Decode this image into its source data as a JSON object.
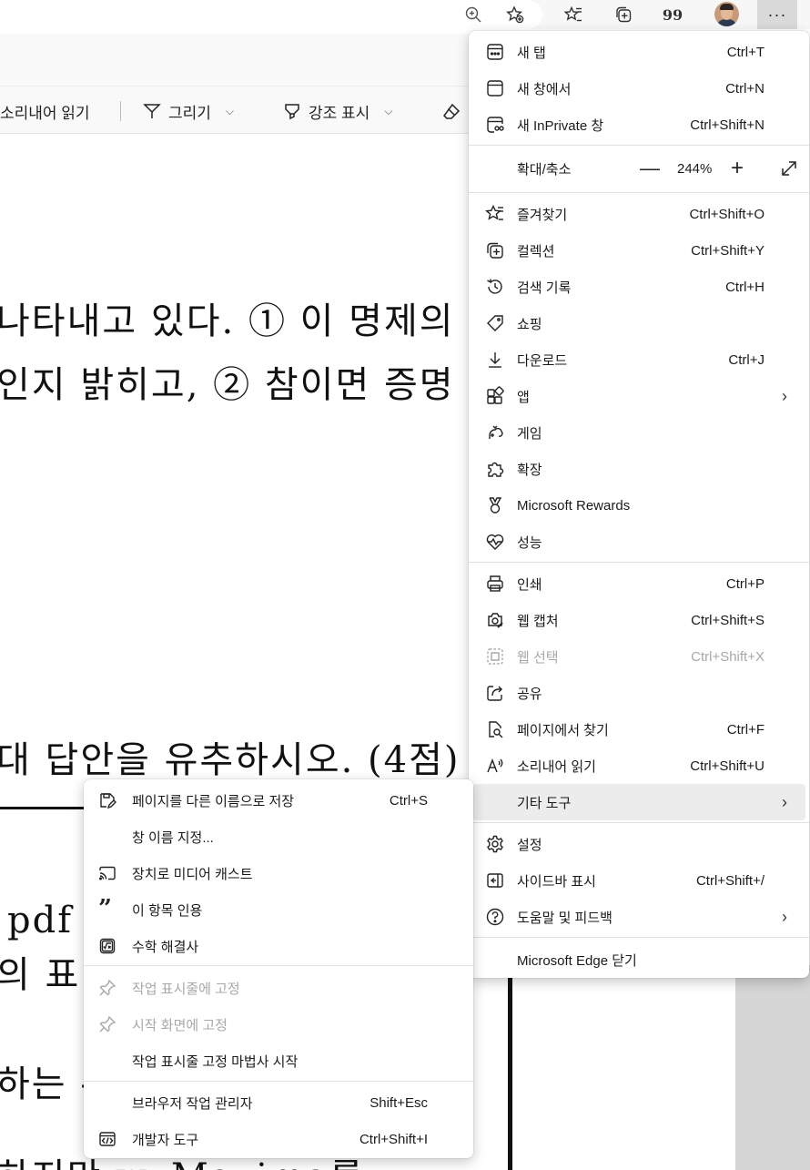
{
  "toolbar": {
    "icons": [
      "zoom-in-icon",
      "favorite-add-icon",
      "favorites-icon",
      "collections-icon",
      "citation-icon",
      "avatar",
      "more-icon"
    ],
    "citation_glyph": "99",
    "more_glyph": "···"
  },
  "pdf_toolbar": {
    "read_aloud": "소리내어 읽기",
    "draw": "그리기",
    "highlight": "강조 표시"
  },
  "document": {
    "line1": "나타내고 있다. ① 이 명제의",
    "line2": "인지 밝히고, ② 참이면 증명",
    "line3": "대 답안을 유추하시오. (4점)",
    "line4": "pdf",
    "line5": "의 표",
    "line6": "하는 -",
    "line7": "하지만 wxMaxima를"
  },
  "menu": {
    "new_tab": {
      "label": "새 탭",
      "shortcut": "Ctrl+T"
    },
    "new_window": {
      "label": "새 창에서",
      "shortcut": "Ctrl+N"
    },
    "inprivate": {
      "label": "새 InPrivate 창",
      "shortcut": "Ctrl+Shift+N"
    },
    "zoom": {
      "label": "확대/축소",
      "minus": "—",
      "value": "244%",
      "plus": "+"
    },
    "favorites": {
      "label": "즐겨찾기",
      "shortcut": "Ctrl+Shift+O"
    },
    "collections": {
      "label": "컬렉션",
      "shortcut": "Ctrl+Shift+Y"
    },
    "history": {
      "label": "검색 기록",
      "shortcut": "Ctrl+H"
    },
    "shopping": {
      "label": "쇼핑"
    },
    "downloads": {
      "label": "다운로드",
      "shortcut": "Ctrl+J"
    },
    "apps": {
      "label": "앱"
    },
    "games": {
      "label": "게임"
    },
    "extensions": {
      "label": "확장"
    },
    "rewards": {
      "label": "Microsoft Rewards"
    },
    "performance": {
      "label": "성능"
    },
    "print": {
      "label": "인쇄",
      "shortcut": "Ctrl+P"
    },
    "web_capture": {
      "label": "웹 캡처",
      "shortcut": "Ctrl+Shift+S"
    },
    "web_select": {
      "label": "웹 선택",
      "shortcut": "Ctrl+Shift+X"
    },
    "share": {
      "label": "공유"
    },
    "find": {
      "label": "페이지에서 찾기",
      "shortcut": "Ctrl+F"
    },
    "read_aloud": {
      "label": "소리내어 읽기",
      "shortcut": "Ctrl+Shift+U"
    },
    "more_tools": {
      "label": "기타 도구"
    },
    "settings": {
      "label": "설정"
    },
    "sidebar": {
      "label": "사이드바 표시",
      "shortcut": "Ctrl+Shift+/"
    },
    "help": {
      "label": "도움말 및 피드백"
    },
    "close": {
      "label": "Microsoft Edge 닫기"
    },
    "arrow": "›"
  },
  "submenu": {
    "save_as": {
      "label": "페이지를 다른 이름으로 저장",
      "shortcut": "Ctrl+S"
    },
    "name_window": {
      "label": "창 이름 지정..."
    },
    "cast": {
      "label": "장치로 미디어 캐스트"
    },
    "cite": {
      "label": "이 항목 인용",
      "glyph": "”"
    },
    "math": {
      "label": "수학 해결사"
    },
    "pin_taskbar": {
      "label": "작업 표시줄에 고정"
    },
    "pin_start": {
      "label": "시작 화면에 고정"
    },
    "pin_wizard": {
      "label": "작업 표시줄 고정 마법사 시작"
    },
    "task_manager": {
      "label": "브라우저 작업 관리자",
      "shortcut": "Shift+Esc"
    },
    "dev_tools": {
      "label": "개발자 도구",
      "shortcut": "Ctrl+Shift+I"
    }
  }
}
